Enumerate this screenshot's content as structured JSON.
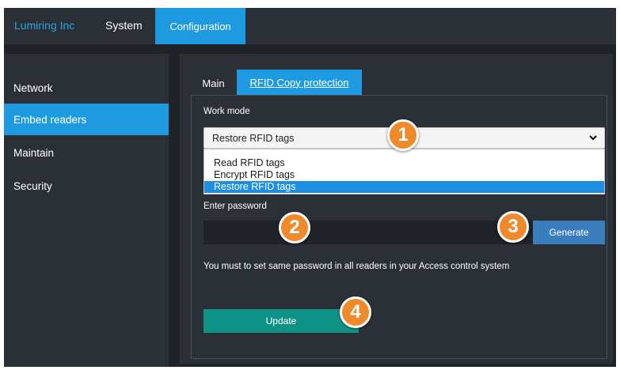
{
  "topbar": {
    "brand": "Lumiring Inc",
    "nav": [
      {
        "label": "System",
        "active": false
      },
      {
        "label": "Configuration",
        "active": true
      }
    ]
  },
  "sidebar": {
    "items": [
      {
        "label": "Network",
        "active": false
      },
      {
        "label": "Embed readers",
        "active": true
      },
      {
        "label": "Maintain",
        "active": false
      },
      {
        "label": "Security",
        "active": false
      }
    ]
  },
  "tabs": [
    {
      "label": "Main",
      "active": false
    },
    {
      "label": "RFID Copy protection",
      "active": true
    }
  ],
  "form": {
    "work_mode_label": "Work mode",
    "work_mode_value": "Restore RFID tags",
    "work_mode_options": [
      "Read RFID tags",
      "Encrypt RFID tags",
      "Restore RFID tags"
    ],
    "password_label": "Enter password",
    "password_value": "",
    "generate_label": "Generate",
    "hint": "You must to set same password in all readers in your Access control system",
    "update_label": "Update"
  },
  "callouts": [
    "1",
    "2",
    "3",
    "4"
  ],
  "colors": {
    "accent": "#1e9be0",
    "background": "#1f2327",
    "panel": "#2b3036",
    "update_button": "#0f9286",
    "generate_button": "#3a7ebd",
    "callout": "#f0892a"
  },
  "icons": {
    "select_arrow": "chevron-down-icon"
  }
}
